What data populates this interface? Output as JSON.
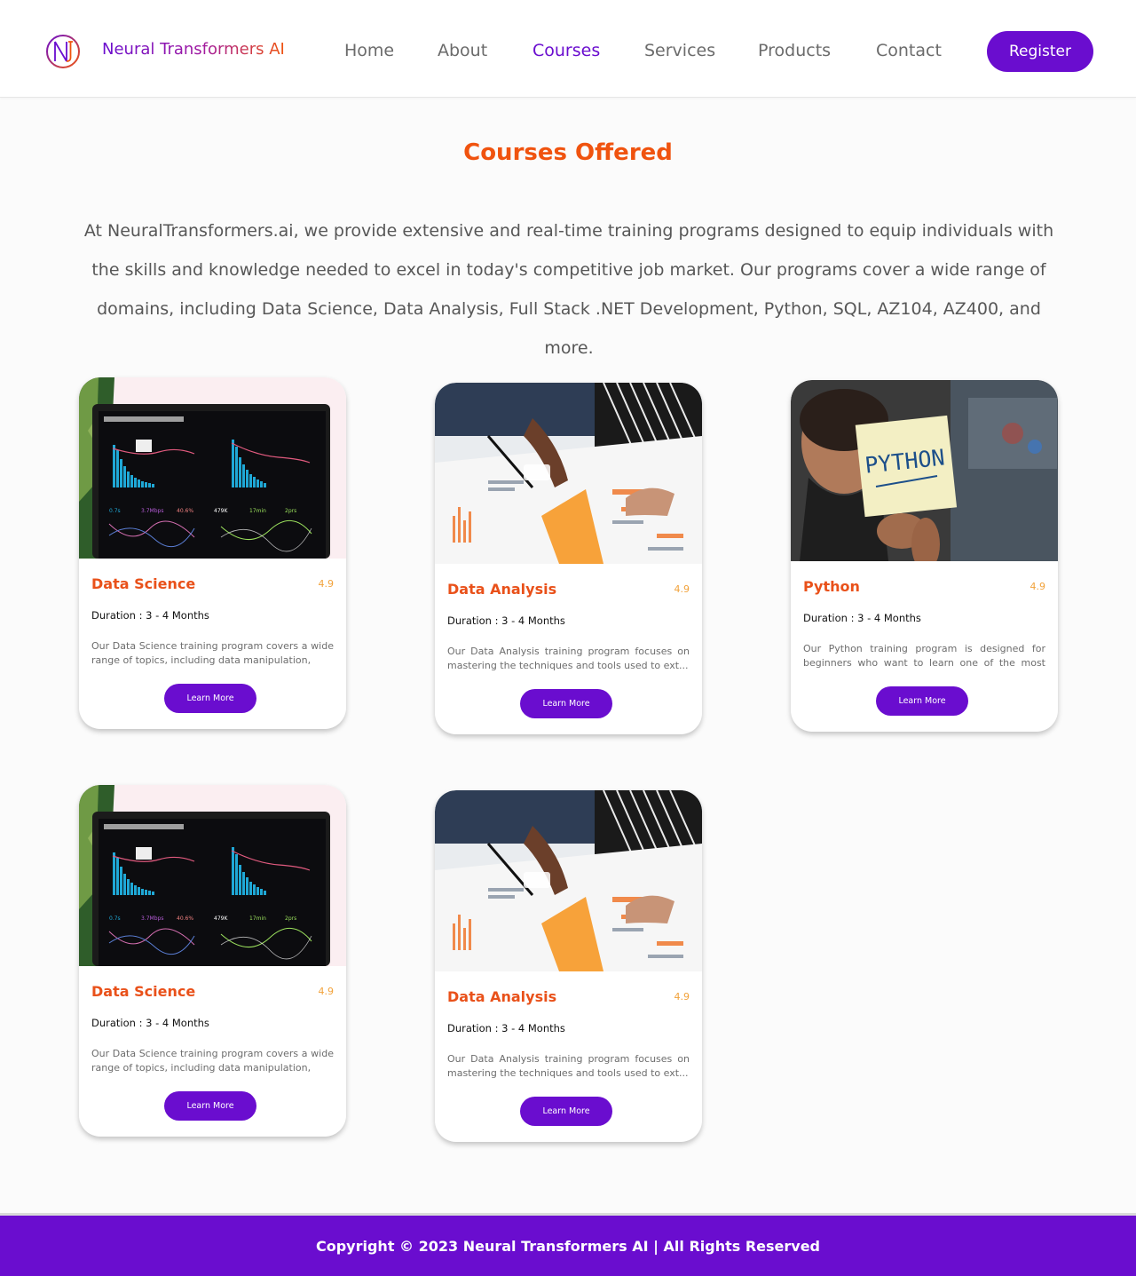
{
  "brand": {
    "name": "Neural Transformers AI"
  },
  "nav": {
    "items": [
      {
        "label": "Home",
        "active": false
      },
      {
        "label": "About",
        "active": false
      },
      {
        "label": "Courses",
        "active": true
      },
      {
        "label": "Services",
        "active": false
      },
      {
        "label": "Products",
        "active": false
      },
      {
        "label": "Contact",
        "active": false
      }
    ],
    "register_label": "Register"
  },
  "page": {
    "title": "Courses Offered",
    "intro": "At NeuralTransformers.ai, we provide extensive and real-time training programs designed to equip individuals with the skills and knowledge needed to excel in today's competitive job market. Our programs cover a wide range of domains, including Data Science, Data Analysis, Full Stack .NET Development, Python, SQL, AZ104, AZ400, and more."
  },
  "courses": [
    {
      "title": "Data Science",
      "rating": "4.9",
      "duration": "Duration : 3 - 4 Months",
      "description": "Our Data Science training program covers a wide range of topics, including data manipulation,",
      "button": "Learn More",
      "image": "analytics-dashboard-laptop"
    },
    {
      "title": "Data Analysis",
      "rating": "4.9",
      "duration": "Duration : 3 - 4 Months",
      "description": "Our Data Analysis training program focuses on mastering the techniques and tools used to ext...",
      "button": "Learn More",
      "image": "people-reviewing-charts"
    },
    {
      "title": "Python",
      "rating": "4.9",
      "duration": "Duration : 3 - 4 Months",
      "description": "Our Python training program is designed for beginners who want to learn one of the most po...",
      "button": "Learn More",
      "image": "python-sticky-note",
      "image_text": "PYTHON"
    },
    {
      "title": "Data Science",
      "rating": "4.9",
      "duration": "Duration : 3 - 4 Months",
      "description": "Our Data Science training program covers a wide range of topics, including data manipulation,",
      "button": "Learn More",
      "image": "analytics-dashboard-laptop"
    },
    {
      "title": "Data Analysis",
      "rating": "4.9",
      "duration": "Duration : 3 - 4 Months",
      "description": "Our Data Analysis training program focuses on mastering the techniques and tools used to ext...",
      "button": "Learn More",
      "image": "people-reviewing-charts"
    }
  ],
  "footer": {
    "copyright": "Copyright © 2023 Neural Transformers AI | All Rights Reserved"
  },
  "colors": {
    "primary": "#6a0dcf",
    "accent": "#f0530f",
    "rating": "#f2a23a"
  }
}
